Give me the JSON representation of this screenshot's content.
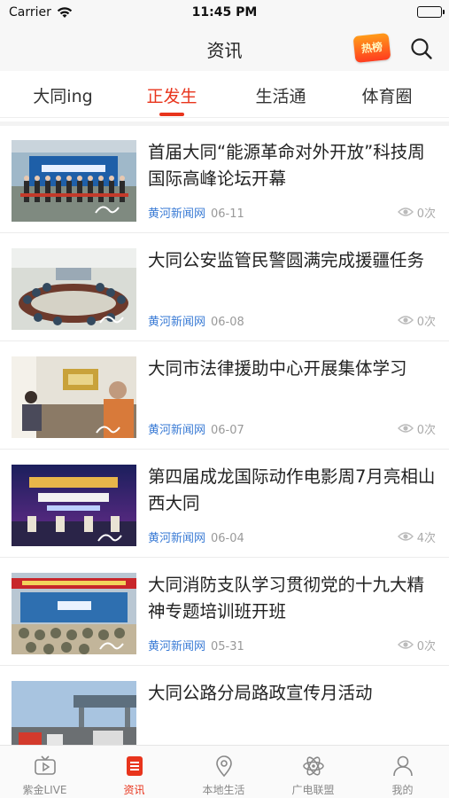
{
  "status_bar": {
    "carrier": "Carrier",
    "time": "11:45 PM"
  },
  "header": {
    "title": "资讯",
    "badge_text": "热榜",
    "search_icon": "search-icon"
  },
  "tabs": [
    {
      "label": "大同ing",
      "active": false
    },
    {
      "label": "正发生",
      "active": true
    },
    {
      "label": "生活通",
      "active": false
    },
    {
      "label": "体育圈",
      "active": false
    }
  ],
  "articles": [
    {
      "title": "首届大同“能源革命对外开放”科技周国际高峰论坛开幕",
      "source": "黄河新闻网",
      "date": "06-11",
      "views": "0次"
    },
    {
      "title": "大同公安监管民警圆满完成援疆任务",
      "source": "黄河新闻网",
      "date": "06-08",
      "views": "0次"
    },
    {
      "title": "大同市法律援助中心开展集体学习",
      "source": "黄河新闻网",
      "date": "06-07",
      "views": "0次"
    },
    {
      "title": "第四届成龙国际动作电影周7月亮相山西大同",
      "source": "黄河新闻网",
      "date": "06-04",
      "views": "4次"
    },
    {
      "title": "大同消防支队学习贯彻党的十九大精神专题培训班开班",
      "source": "黄河新闻网",
      "date": "05-31",
      "views": "0次"
    },
    {
      "title": "大同公路分局路政宣传月活动",
      "source": "",
      "date": "",
      "views": ""
    }
  ],
  "tabbar": [
    {
      "label": "紫金LIVE",
      "icon": "tv-play-icon",
      "active": false
    },
    {
      "label": "资讯",
      "icon": "news-list-icon",
      "active": true
    },
    {
      "label": "本地生活",
      "icon": "location-pin-icon",
      "active": false
    },
    {
      "label": "广电联盟",
      "icon": "atom-icon",
      "active": false
    },
    {
      "label": "我的",
      "icon": "person-icon",
      "active": false
    }
  ],
  "colors": {
    "accent": "#e8341c",
    "source_blue": "#3a7bd5",
    "meta_gray": "#999999"
  }
}
